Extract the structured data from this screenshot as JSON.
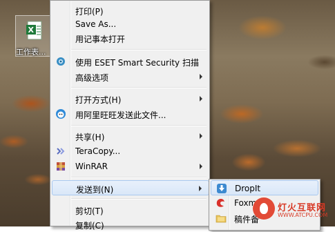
{
  "desktop": {
    "icon_label": "工作表..."
  },
  "context_menu": {
    "items": [
      {
        "label": "打印(P)",
        "icon": null,
        "submenu": false
      },
      {
        "label": "Save As...",
        "icon": null,
        "submenu": false
      },
      {
        "label": "用记事本打开",
        "icon": null,
        "submenu": false
      },
      {
        "label": "使用 ESET Smart Security 扫描",
        "icon": "eset-icon",
        "submenu": false
      },
      {
        "label": "高级选项",
        "icon": null,
        "submenu": true
      },
      {
        "label": "打开方式(H)",
        "icon": null,
        "submenu": true
      },
      {
        "label": "用阿里旺旺发送此文件...",
        "icon": "aliwangwang-icon",
        "submenu": false
      },
      {
        "label": "共享(H)",
        "icon": null,
        "submenu": true
      },
      {
        "label": "TeraCopy...",
        "icon": "teracopy-icon",
        "submenu": false
      },
      {
        "label": "WinRAR",
        "icon": "winrar-icon",
        "submenu": true
      },
      {
        "label": "发送到(N)",
        "icon": null,
        "submenu": true,
        "highlighted": true
      },
      {
        "label": "剪切(T)",
        "icon": null,
        "submenu": false
      },
      {
        "label": "复制(C)",
        "icon": null,
        "submenu": false
      }
    ]
  },
  "send_to_submenu": {
    "items": [
      {
        "label": "DropIt",
        "icon": "dropit-icon",
        "highlighted": true
      },
      {
        "label": "Foxm",
        "icon": "foxmail-icon"
      },
      {
        "label": "稿件备",
        "icon": "folder-icon"
      }
    ]
  },
  "watermark": {
    "title": "灯火互联网",
    "url": "WWW.ATCPU.COM"
  }
}
